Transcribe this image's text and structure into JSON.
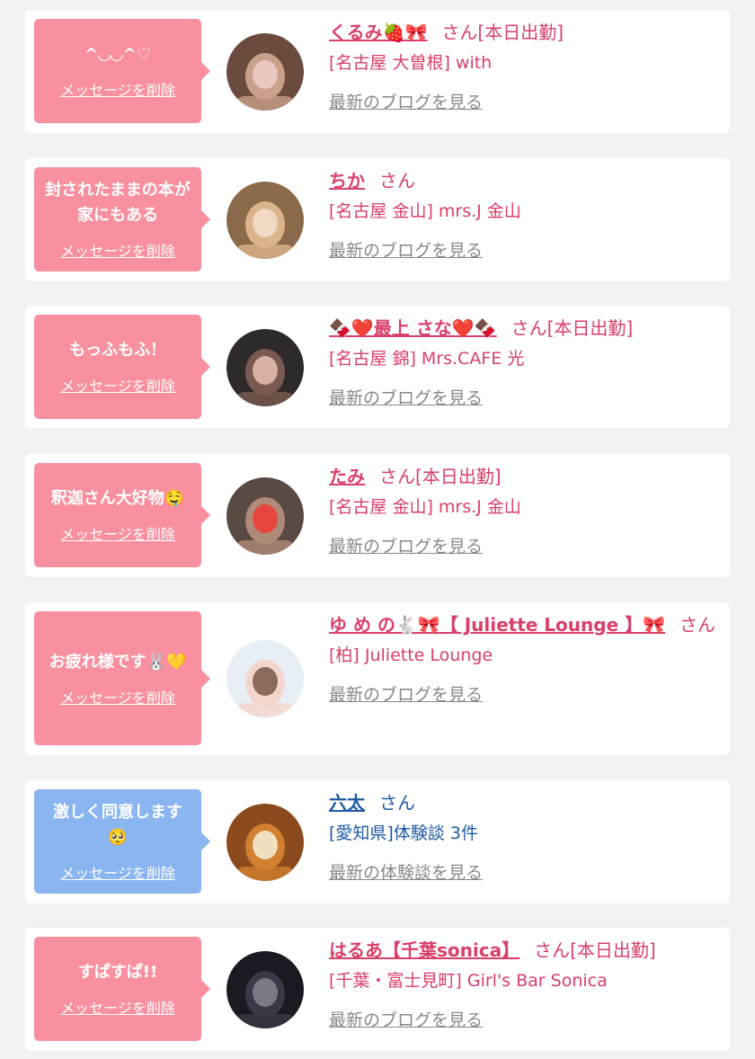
{
  "delete_label": "メッセージを削除",
  "san_label": "さん",
  "colors": {
    "page_bg": "#f2f2f2",
    "card_bg": "#ffffff",
    "pink_bubble": "#f8909f",
    "blue_bubble": "#8ab5f0",
    "name_pink": "#d9406a",
    "name_blue": "#1f5aa5",
    "link_gray": "#888888"
  },
  "cards": [
    {
      "message": "^◡◡^♡",
      "bubble_color": "pink",
      "avatar_icon": "avatar-photo-icon",
      "name": "くるみ🍓🎀",
      "status": "[本日出勤]",
      "shop": "[名古屋 大曽根] with",
      "link": "最新のブログを見る",
      "theme": "pink"
    },
    {
      "message": "封されたままの本が家にもある",
      "bubble_color": "pink",
      "avatar_icon": "avatar-photo-icon",
      "name": "ちか",
      "status": "",
      "shop": "[名古屋 金山] mrs.J 金山",
      "link": "最新のブログを見る",
      "theme": "pink"
    },
    {
      "message": "もっふもふ！",
      "bubble_color": "pink",
      "avatar_icon": "avatar-photo-icon",
      "name": "🍫❤️最上 さな❤️🍫",
      "status": "[本日出勤]",
      "shop": "[名古屋 錦] Mrs.CAFE 光",
      "link": "最新のブログを見る",
      "theme": "pink"
    },
    {
      "message": "釈迦さん大好物🤤",
      "bubble_color": "pink",
      "avatar_icon": "avatar-photo-icon",
      "name": "たみ",
      "status": "[本日出勤]",
      "shop": "[名古屋 金山] mrs.J 金山",
      "link": "最新のブログを見る",
      "theme": "pink"
    },
    {
      "message": "お疲れ様です🐰💛",
      "bubble_color": "pink",
      "avatar_icon": "avatar-photo-icon",
      "name": "ゆ め の🐇🎀【 Juliette Lounge 】🎀",
      "status": "",
      "shop": "[柏] Juliette Lounge",
      "link": "最新のブログを見る",
      "theme": "pink"
    },
    {
      "message": "激しく同意します🥺",
      "bubble_color": "blue",
      "avatar_icon": "avatar-food-photo-icon",
      "name": "六太",
      "status": "",
      "shop": "[愛知県]体験談 3件",
      "link": "最新の体験談を見る",
      "theme": "blue"
    },
    {
      "message": "すぱすぱ!!",
      "bubble_color": "pink",
      "avatar_icon": "avatar-photo-icon",
      "name": "はるあ【千葉sonica】",
      "status": "[本日出勤]",
      "shop": "[千葉・富士見町] Girl's Bar Sonica",
      "link": "最新のブログを見る",
      "theme": "pink"
    }
  ]
}
